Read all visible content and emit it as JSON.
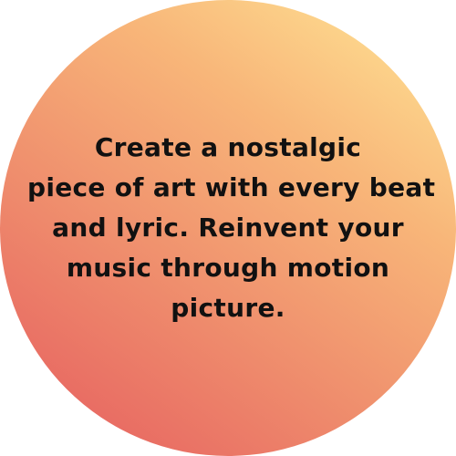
{
  "tagline": {
    "lines": [
      "Create a nostalgic",
      "piece of art with every beat",
      "and lyric. Reinvent your",
      "music through motion",
      "picture."
    ]
  },
  "colors": {
    "gradient_top_right": "#ffe897",
    "gradient_mid": "#ef8e6d",
    "gradient_bottom_left": "#e55a5e",
    "text": "#111111",
    "background": "#ffffff"
  }
}
